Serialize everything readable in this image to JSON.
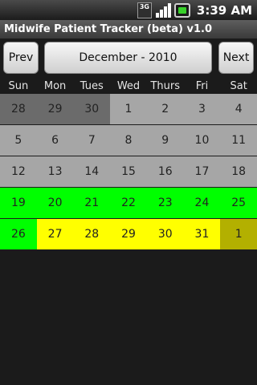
{
  "status": {
    "network_label": "3G",
    "time": "3:39 AM",
    "icons": [
      "network-3g-icon",
      "signal-icon",
      "battery-icon"
    ]
  },
  "app": {
    "title": "Midwife Patient Tracker (beta) v1.0"
  },
  "nav": {
    "prev_label": "Prev",
    "month_label": "December - 2010",
    "next_label": "Next"
  },
  "weekdays": [
    "Sun",
    "Mon",
    "Tues",
    "Wed",
    "Thurs",
    "Fri",
    "Sat"
  ],
  "colors": {
    "outside_month": "#6b6b6b",
    "default_day": "#a6a6a6",
    "green_day": "#00ff00",
    "yellow_day": "#ffff00",
    "olive_day": "#b3b000"
  },
  "weeks": [
    [
      {
        "day": "28",
        "color": "#6b6b6b"
      },
      {
        "day": "29",
        "color": "#6b6b6b"
      },
      {
        "day": "30",
        "color": "#6b6b6b"
      },
      {
        "day": "1",
        "color": "#a6a6a6"
      },
      {
        "day": "2",
        "color": "#a6a6a6"
      },
      {
        "day": "3",
        "color": "#a6a6a6"
      },
      {
        "day": "4",
        "color": "#a6a6a6"
      }
    ],
    [
      {
        "day": "5",
        "color": "#a6a6a6"
      },
      {
        "day": "6",
        "color": "#a6a6a6"
      },
      {
        "day": "7",
        "color": "#a6a6a6"
      },
      {
        "day": "8",
        "color": "#a6a6a6"
      },
      {
        "day": "9",
        "color": "#a6a6a6"
      },
      {
        "day": "10",
        "color": "#a6a6a6"
      },
      {
        "day": "11",
        "color": "#a6a6a6"
      }
    ],
    [
      {
        "day": "12",
        "color": "#a6a6a6"
      },
      {
        "day": "13",
        "color": "#a6a6a6"
      },
      {
        "day": "14",
        "color": "#a6a6a6"
      },
      {
        "day": "15",
        "color": "#a6a6a6"
      },
      {
        "day": "16",
        "color": "#a6a6a6"
      },
      {
        "day": "17",
        "color": "#a6a6a6"
      },
      {
        "day": "18",
        "color": "#a6a6a6"
      }
    ],
    [
      {
        "day": "19",
        "color": "#00ff00"
      },
      {
        "day": "20",
        "color": "#00ff00"
      },
      {
        "day": "21",
        "color": "#00ff00"
      },
      {
        "day": "22",
        "color": "#00ff00"
      },
      {
        "day": "23",
        "color": "#00ff00"
      },
      {
        "day": "24",
        "color": "#00ff00"
      },
      {
        "day": "25",
        "color": "#00ff00"
      }
    ],
    [
      {
        "day": "26",
        "color": "#00ff00"
      },
      {
        "day": "27",
        "color": "#ffff00"
      },
      {
        "day": "28",
        "color": "#ffff00"
      },
      {
        "day": "29",
        "color": "#ffff00"
      },
      {
        "day": "30",
        "color": "#ffff00"
      },
      {
        "day": "31",
        "color": "#ffff00"
      },
      {
        "day": "1",
        "color": "#b3b000"
      }
    ]
  ]
}
